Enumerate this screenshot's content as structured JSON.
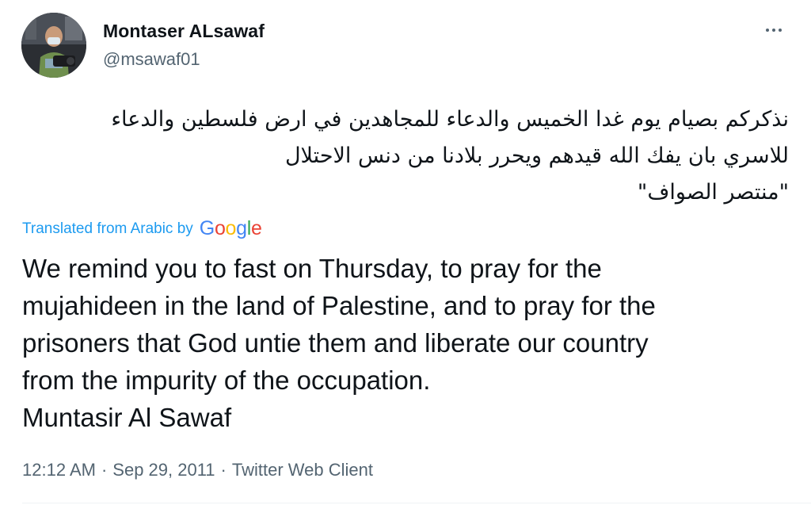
{
  "author": {
    "name": "Montaser ALsawaf",
    "handle": "@msawaf01"
  },
  "more_icon": "ellipsis-icon",
  "tweet": {
    "arabic_lines": [
      "نذكركم بصيام يوم غدا الخميس والدعاء للمجاهدين في ارض فلسطين والدعاء",
      "للاسري بان يفك الله قيدهم ويحرر بلادنا من دنس الاحتلال",
      "\"منتصر الصواف\""
    ],
    "translated_label": "Translated from Arabic by",
    "google_logo": {
      "letters": [
        "G",
        "o",
        "o",
        "g",
        "l",
        "e"
      ],
      "colors": [
        "#4285F4",
        "#EA4335",
        "#FBBC05",
        "#4285F4",
        "#34A853",
        "#EA4335"
      ]
    },
    "translation_lines": [
      "We remind you to fast on Thursday, to pray for the",
      "mujahideen in the land of Palestine, and to pray for the",
      "prisoners that God untie them and liberate our country",
      "from the impurity of the occupation.",
      "Muntasir Al Sawaf"
    ]
  },
  "meta": {
    "time": "12:12 AM",
    "separator": "·",
    "date": "Sep 29, 2011",
    "client": "Twitter Web Client"
  },
  "colors": {
    "link_blue": "#1d9bf0",
    "secondary_gray": "#536471",
    "text": "#0f1419"
  }
}
